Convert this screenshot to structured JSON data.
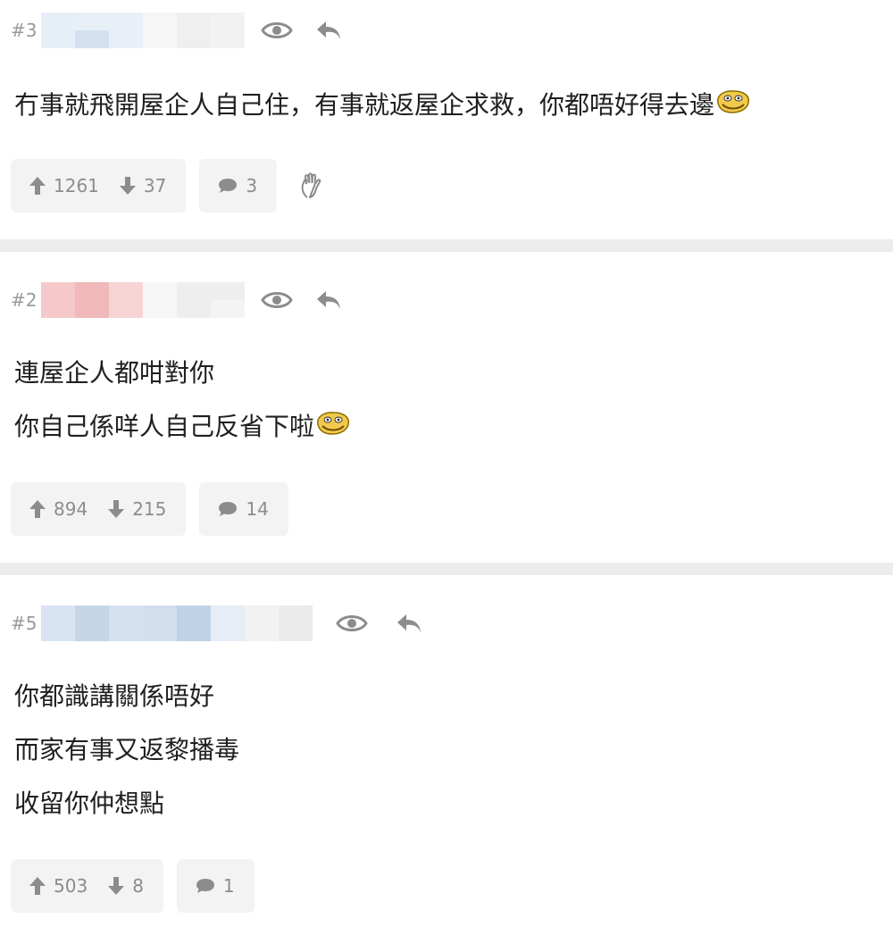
{
  "posts": [
    {
      "floor": "#3",
      "lines": [
        "冇事就飛開屋企人自己住，有事就返屋企求救，你都唔好得去邊"
      ],
      "upvotes": "1261",
      "downvotes": "37",
      "replies": "3",
      "has_emoji": true,
      "mosaic_colors": [
        "#e6eef8",
        "#d3e0f0",
        "#e8eff7",
        "#f6f6f6",
        "#efefef",
        "#f2f2f2"
      ]
    },
    {
      "floor": "#2",
      "lines": [
        "連屋企人都咁對你",
        "你自己係咩人自己反省下啦"
      ],
      "upvotes": "894",
      "downvotes": "215",
      "replies": "14",
      "has_emoji": true,
      "mosaic_colors": [
        "#f5c9c9",
        "#f0b8b8",
        "#f7d5d5",
        "#f6f6f6",
        "#eeeeee",
        "#f1f1f1"
      ]
    },
    {
      "floor": "#5",
      "lines": [
        "你都識講關係唔好",
        "而家有事又返黎播毒",
        "收留你仲想點"
      ],
      "upvotes": "503",
      "downvotes": "8",
      "replies": "1",
      "has_emoji": false,
      "mosaic_colors": [
        "#d8e4f1",
        "#c6d6e9",
        "#d4e1ef",
        "#d1deed",
        "#c0d2e7",
        "#e6edf6",
        "#f2f2f2",
        "#ebebeb"
      ]
    }
  ],
  "colors": {
    "icon_gray": "#8c8c8c",
    "pill_bg": "#f3f3f3",
    "divider": "#ececec"
  },
  "icons": {
    "view": "eye-icon",
    "reply": "reply-arrow-icon",
    "upvote": "arrow-up-icon",
    "downvote": "arrow-down-icon",
    "comment": "speech-bubble-icon",
    "wave": "waving-hand-icon",
    "emoji": "smiley-emoticon"
  }
}
